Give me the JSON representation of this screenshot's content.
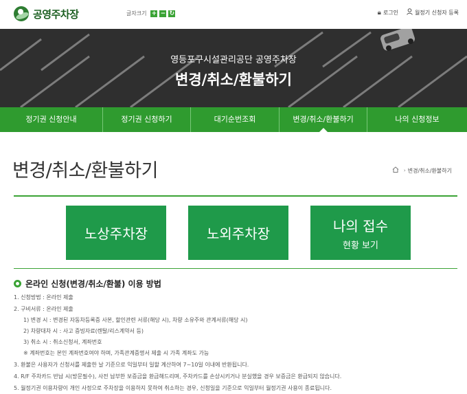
{
  "header": {
    "logo_text": "공영주차장",
    "font_size_label": "글자크기",
    "font_size_buttons": [
      "+",
      "−",
      "↻"
    ],
    "login_label": "로그인",
    "register_label": "월정기 신청자 등록"
  },
  "hero": {
    "subtitle": "영등포구시설관리공단 공영주차장",
    "title": "변경/취소/환불하기"
  },
  "nav": {
    "items": [
      "정기권 신청안내",
      "정기권 신청하기",
      "대기순번조회",
      "변경/취소/환불하기",
      "나의 신청정보"
    ],
    "active_index": 3
  },
  "page": {
    "title": "변경/취소/환불하기",
    "breadcrumb": "변경/취소/환불하기"
  },
  "buttons": {
    "street": "노상주차장",
    "offstreet": "노외주차장",
    "my_apply_line1": "나의 접수",
    "my_apply_line2": "현황 보기"
  },
  "info": {
    "heading": "온라인 신청(변경/취소/환불) 이용 방법",
    "lines": [
      "1. 신청방법 : 온라인 제출",
      "2. 구비서류 : 온라인 제출",
      "1) 변경 시 : 변경된 자동차등록증 사본, 할인관련 서류(해당 시), 차량 소유주와 관계서류(해당 시)",
      "2) 차량대차 시 : 사고 증빙자료(렌탈/리스계약서 등)",
      "3) 취소 시 : 취소신청서, 계좌번호",
      "※ 계좌번호는 본인 계좌번호여야 하며, 가족관계증명서 제출 시 가족 계좌도 가능",
      "3. 환불은 사용자가 신청서를 제출한 날 기준으로 익일부터 일할 계산하여 7~10일 이내에 반환됩니다.",
      "4. R/F 주차카드 반납 시(방문필수), 사전 납부한 보증금을 환급해드리며, 주차카드를 손상시키거나 분실했을 경우 보증금은 환급되지 않습니다.",
      "5. 월정기권 이용차량이 개인 사정으로 주차장을 이용하지 못하여 취소하는 경우, 신청일을 기준으로 익일부터 월정기권 사용이 종료됩니다."
    ]
  },
  "colors": {
    "nav_green": "#2f9b2f",
    "button_green": "#1f9a4a",
    "accent_green": "#3aa335"
  }
}
